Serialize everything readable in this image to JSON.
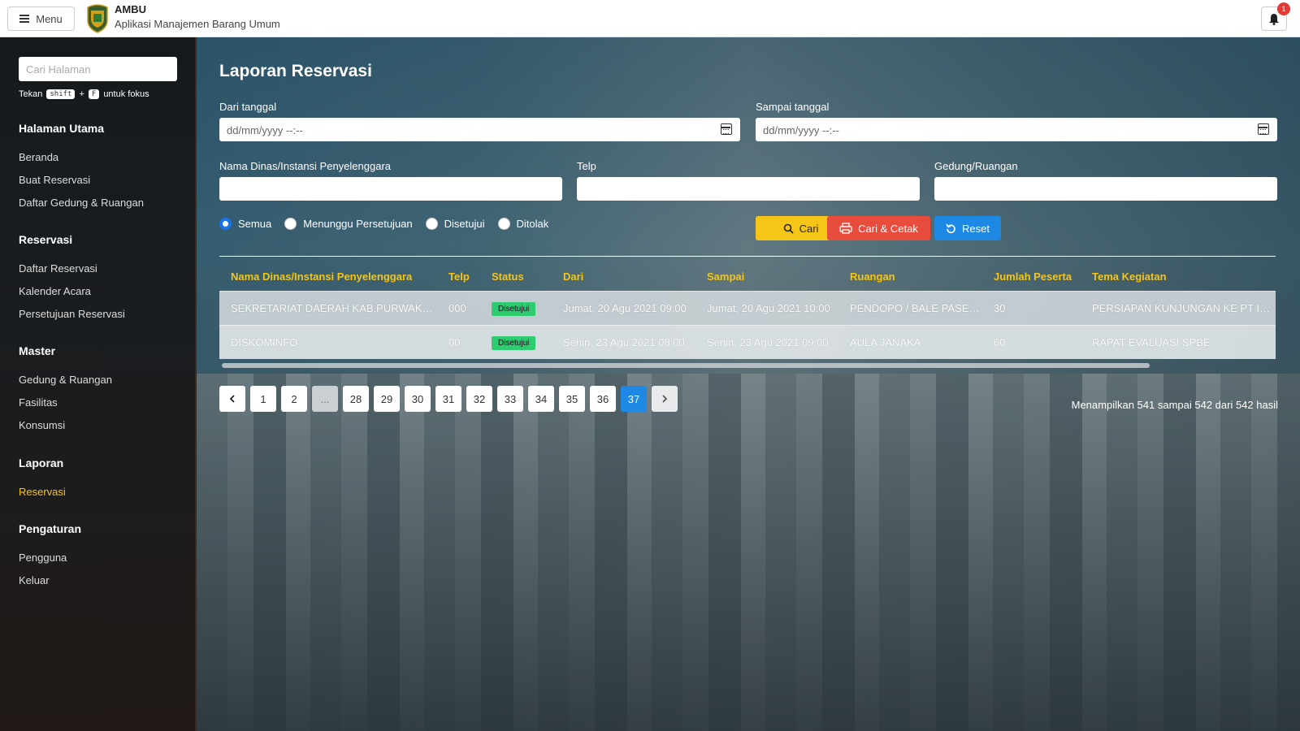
{
  "header": {
    "menu_label": "Menu",
    "app_name": "AMBU",
    "app_subtitle": "Aplikasi Manajemen Barang Umum",
    "notification_count": "1"
  },
  "sidebar": {
    "search_placeholder": "Cari Halaman",
    "hint_prefix": "Tekan",
    "hint_key1": "shift",
    "hint_plus": "+",
    "hint_key2": "F",
    "hint_suffix": "untuk fokus",
    "groups": [
      {
        "heading": "Halaman Utama",
        "items": [
          "Beranda",
          "Buat Reservasi",
          "Daftar Gedung & Ruangan"
        ]
      },
      {
        "heading": "Reservasi",
        "items": [
          "Daftar Reservasi",
          "Kalender Acara",
          "Persetujuan Reservasi"
        ]
      },
      {
        "heading": "Master",
        "items": [
          "Gedung & Ruangan",
          "Fasilitas",
          "Konsumsi"
        ]
      },
      {
        "heading": "Laporan",
        "items": [
          "Reservasi"
        ]
      },
      {
        "heading": "Pengaturan",
        "items": [
          "Pengguna",
          "Keluar"
        ]
      }
    ],
    "active_item": "Reservasi"
  },
  "page": {
    "title": "Laporan Reservasi",
    "filters": {
      "from_label": "Dari tanggal",
      "from_placeholder": "dd/mm/yyyy --:--",
      "to_label": "Sampai tanggal",
      "to_placeholder": "dd/mm/yyyy --:--",
      "org_label": "Nama Dinas/Instansi Penyelenggara",
      "org_value": "",
      "phone_label": "Telp",
      "phone_value": "",
      "room_label": "Gedung/Ruangan",
      "room_value": ""
    },
    "status_options": [
      "Semua",
      "Menunggu Persetujuan",
      "Disetujui",
      "Ditolak"
    ],
    "status_selected": "Semua",
    "buttons": {
      "search": "Cari",
      "search_print": "Cari & Cetak",
      "reset": "Reset"
    }
  },
  "table": {
    "columns": [
      "Nama Dinas/Instansi Penyelenggara",
      "Telp",
      "Status",
      "Dari",
      "Sampai",
      "Ruangan",
      "Jumlah Peserta",
      "Tema Kegiatan"
    ],
    "rows": [
      [
        "SEKRETARIAT DAERAH KAB.PURWAKARTA",
        "000",
        "Disetujui",
        "Jumat, 20 Agu 2021 09:00",
        "Jumat, 20 Agu 2021 10:00",
        "PENDOPO / BALE PASEB...",
        "30",
        "PERSIAPAN KUNJUNGAN KE PT INDOFO"
      ],
      [
        "DISKOMINFO",
        "00",
        "Disetujui",
        "Senin, 23 Agu 2021 08:00",
        "Senin, 23 Agu 2021 09:00",
        "AULA JANAKA",
        "60",
        "RAPAT EVALUASI SPBE"
      ]
    ]
  },
  "pagination": {
    "pages": [
      "1",
      "2",
      "...",
      "28",
      "29",
      "30",
      "31",
      "32",
      "33",
      "34",
      "35",
      "36",
      "37"
    ],
    "current": "37",
    "summary": "Menampilkan 541 sampai 542 dari 542 hasil"
  },
  "colors": {
    "accent": "#f5c518",
    "primary": "#1e88e5",
    "danger": "#e74c3c",
    "success": "#2ecc71"
  }
}
